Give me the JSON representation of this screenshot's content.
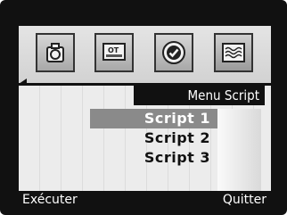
{
  "icons": [
    "camera-icon",
    "settings-display-icon",
    "checkmark-circle-icon",
    "script-waves-icon"
  ],
  "selected_tab": "script-waves-icon",
  "menu": {
    "title": "Menu Script",
    "items": [
      "Script 1",
      "Script 2",
      "Script 3"
    ],
    "selected_item": "Script 1"
  },
  "softkeys": {
    "left": "Exécuter",
    "right": "Quitter"
  }
}
